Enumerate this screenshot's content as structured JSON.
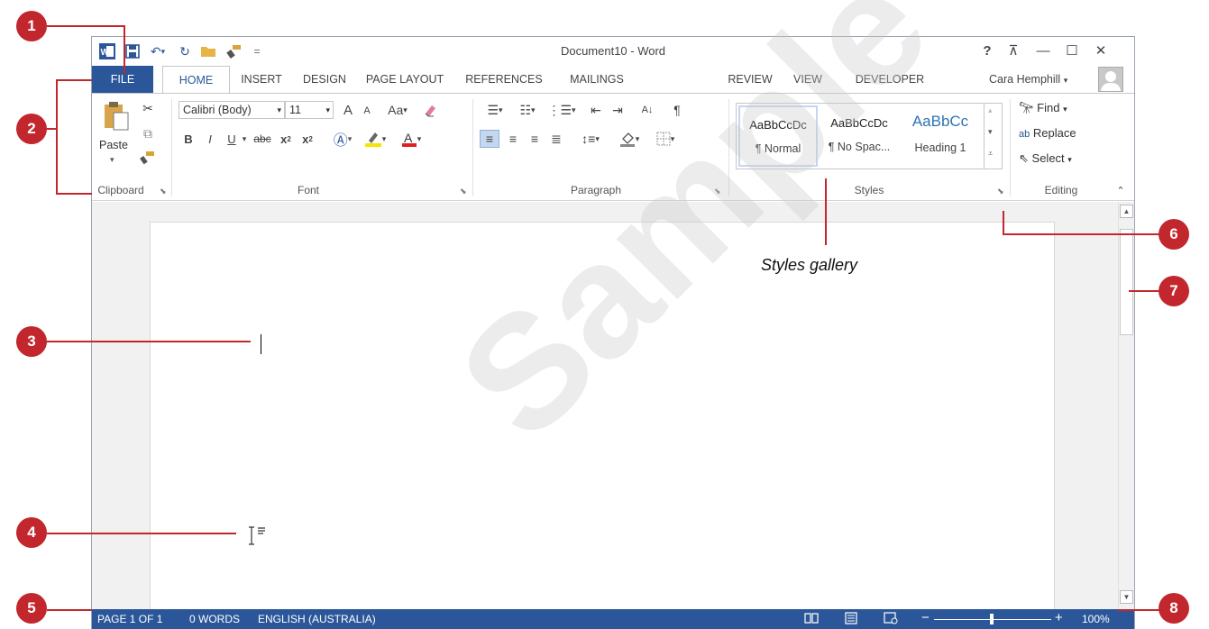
{
  "window": {
    "title": "Document10 - Word",
    "help": "?",
    "qat": {
      "undo": "↶",
      "redo": "↻",
      "customize": "="
    },
    "controls": {
      "restore_ribbon": "⊼",
      "minimize": "—",
      "maximize": "☐",
      "close": "✕"
    }
  },
  "tabs": [
    "FILE",
    "HOME",
    "INSERT",
    "DESIGN",
    "PAGE LAYOUT",
    "REFERENCES",
    "MAILINGS",
    "REVIEW",
    "VIEW",
    "DEVELOPER"
  ],
  "user": {
    "name": "Cara Hemphill"
  },
  "ribbon": {
    "clipboard": {
      "label": "Clipboard",
      "paste": "Paste"
    },
    "font": {
      "label": "Font",
      "font_name": "Calibri (Body)",
      "font_size": "11",
      "grow": "A",
      "shrink": "A",
      "change_case": "Aa",
      "bold": "B",
      "italic": "I",
      "underline": "U",
      "strikethrough": "abc",
      "subscript": "x",
      "superscript": "x"
    },
    "paragraph": {
      "label": "Paragraph",
      "sort": "A↓",
      "show_marks": "¶"
    },
    "styles": {
      "label": "Styles",
      "items": [
        {
          "sample": "AaBbCcDc",
          "name": "¶ Normal"
        },
        {
          "sample": "AaBbCcDc",
          "name": "¶ No Spac..."
        },
        {
          "sample": "AaBbCc",
          "name": "Heading 1"
        }
      ]
    },
    "editing": {
      "label": "Editing",
      "find": "Find",
      "replace": "Replace",
      "select": "Select"
    }
  },
  "status": {
    "page": "PAGE 1 OF 1",
    "words": "0 WORDS",
    "language": "ENGLISH (AUSTRALIA)",
    "zoom": "100%",
    "zoom_minus": "−",
    "zoom_plus": "+"
  },
  "annotations": {
    "callouts": [
      "1",
      "2",
      "3",
      "4",
      "5",
      "6",
      "7",
      "8"
    ],
    "styles_gallery": "Styles gallery"
  },
  "watermark": "Sample",
  "colors": {
    "accent": "#2b579a",
    "callout": "#c1272d"
  }
}
